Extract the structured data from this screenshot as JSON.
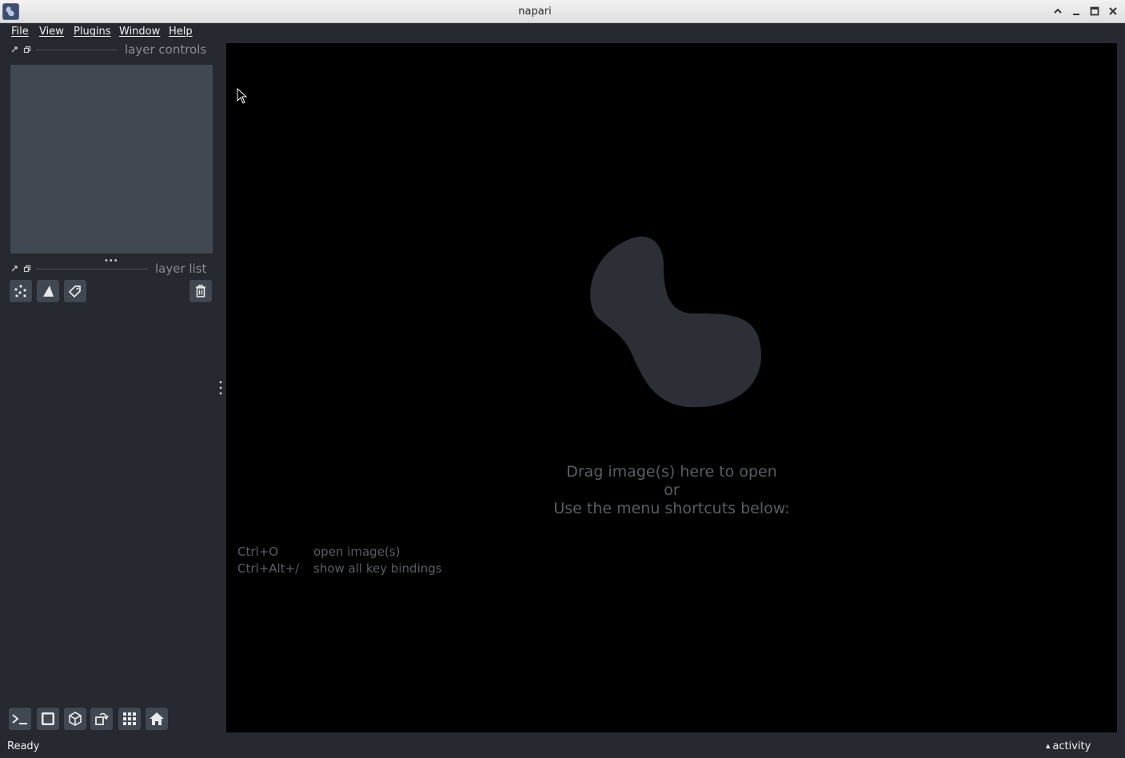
{
  "window": {
    "title": "napari"
  },
  "menu": [
    {
      "label": "File"
    },
    {
      "label": "View"
    },
    {
      "label": "Plugins"
    },
    {
      "label": "Window"
    },
    {
      "label": "Help"
    }
  ],
  "docks": {
    "layer_controls_title": "layer controls",
    "layer_list_title": "layer list",
    "splitter_handle": "•••"
  },
  "welcome": {
    "line1": "Drag image(s) here to open",
    "line2": "or",
    "line3": "Use the menu shortcuts below:",
    "shortcuts": [
      {
        "key": "Ctrl+O",
        "desc": "open image(s)"
      },
      {
        "key": "Ctrl+Alt+/",
        "desc": "show all key bindings"
      }
    ]
  },
  "layer_buttons": [
    "new-points-icon",
    "new-shapes-icon",
    "new-labels-icon",
    "delete-layer-icon"
  ],
  "viewer_buttons": [
    "console-icon",
    "ndisplay-icon",
    "roll-dims-icon",
    "transpose-icon",
    "grid-icon",
    "home-icon"
  ],
  "status": {
    "text": "Ready",
    "activity_label": "activity",
    "activity_arrow": "▲"
  },
  "colors": {
    "background": "#262930",
    "panel": "#414851",
    "canvas": "#000000",
    "logo_blob": "#2c2f35",
    "text_dim": "#595d64"
  }
}
